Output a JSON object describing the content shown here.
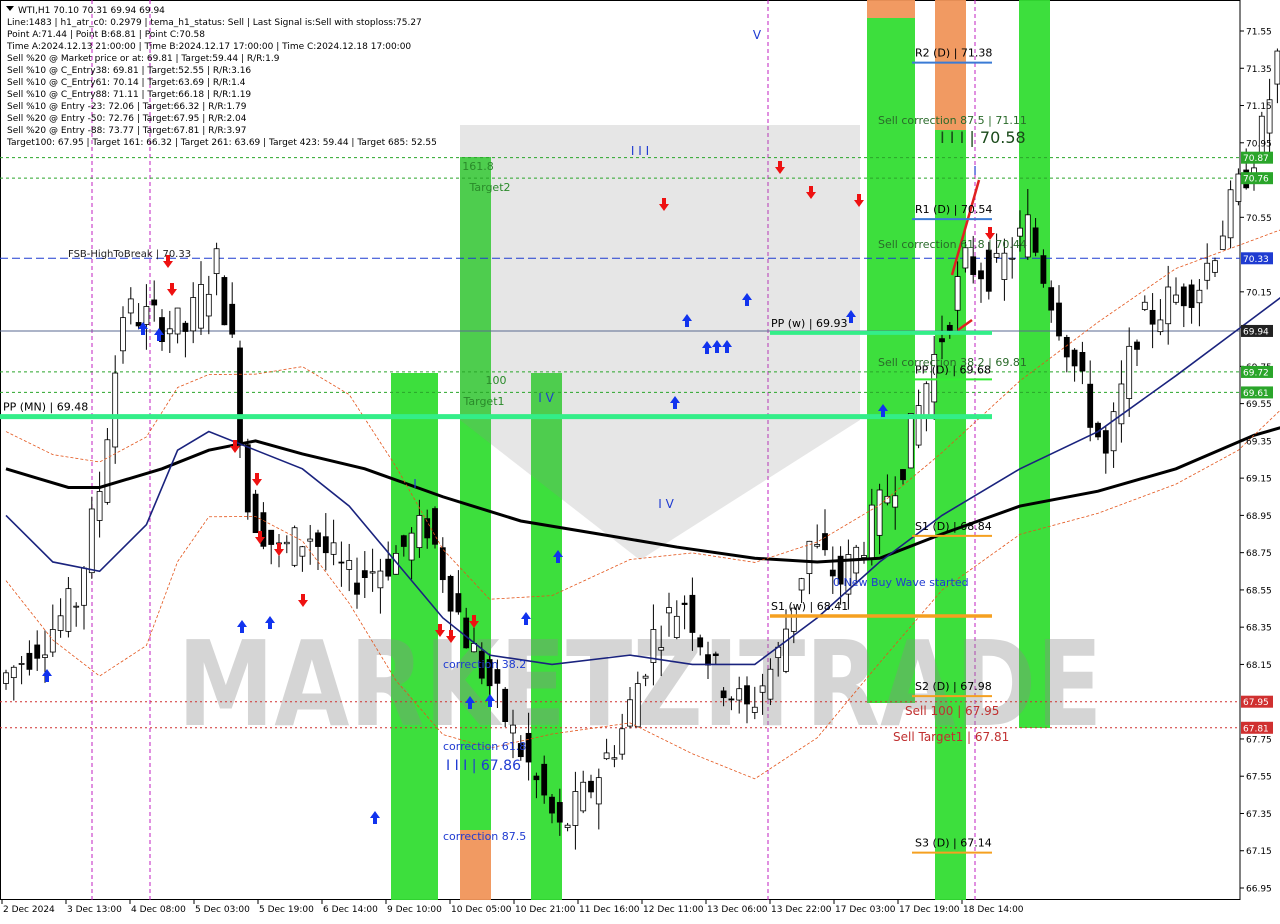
{
  "header": {
    "lines": [
      "WTI,H1  70.10 70.31 69.94 69.94",
      "Line:1483  | h1_atr_c0: 0.2979  | tema_h1_status: Sell  | Last Signal is:Sell with stoploss:75.27",
      "Point A:71.44  | Point B:68.81  | Point C:70.58",
      "Time A:2024.12.13 21:00:00  | Time B:2024.12.17 17:00:00  | Time C:2024.12.18 17:00:00",
      "Sell %20 @ Market price or at: 69.81  | Target:59.44  | R/R:1.9",
      "Sell %10 @ C_Entry38: 69.81  | Target:52.55  | R/R:3.16",
      "Sell %10 @ C_Entry61: 70.14  | Target:63.69  | R/R:1.4",
      "Sell %10 @ C_Entry88: 71.11  | Target:66.18  | R/R:1.19",
      "Sell %10 @ Entry -23: 72.06  | Target:66.32  | R/R:1.79",
      "Sell %20 @ Entry -50: 72.76  | Target:67.95  | R/R:2.04",
      "Sell %20 @ Entry -88: 73.77  | Target:67.81  | R/R:3.97",
      "Target100: 67.95  | Target 161: 66.32  | Target 261: 63.69  | Target 423: 59.44  | Target 685: 52.55"
    ]
  },
  "chart_data": {
    "type": "line",
    "symbol": "WTI",
    "timeframe": "H1",
    "ylim": [
      66.85,
      71.65
    ],
    "y_ticks": [
      71.55,
      71.35,
      71.15,
      70.95,
      70.55,
      70.15,
      69.75,
      69.55,
      69.35,
      69.15,
      68.95,
      68.75,
      68.55,
      68.35,
      68.15,
      67.75,
      67.55,
      67.35,
      67.15,
      66.95
    ],
    "x_labels": [
      "2 Dec 2024",
      "3 Dec 13:00",
      "4 Dec 08:00",
      "5 Dec 03:00",
      "5 Dec 19:00",
      "6 Dec 14:00",
      "9 Dec 10:00",
      "10 Dec 05:00",
      "10 Dec 21:00",
      "11 Dec 16:00",
      "12 Dec 11:00",
      "13 Dec 06:00",
      "13 Dec 22:00",
      "17 Dec 03:00",
      "17 Dec 19:00",
      "18 Dec 14:00"
    ],
    "price_tags": [
      {
        "label": "70.87",
        "value": 70.87,
        "color": "#2aa52a"
      },
      {
        "label": "70.76",
        "value": 70.76,
        "color": "#2aa52a"
      },
      {
        "label": "70.33",
        "value": 70.33,
        "color": "#1f3bd1"
      },
      {
        "label": "69.94",
        "value": 69.94,
        "color": "#222222"
      },
      {
        "label": "69.72",
        "value": 69.72,
        "color": "#2aa52a"
      },
      {
        "label": "69.61",
        "value": 69.61,
        "color": "#2aa52a"
      },
      {
        "label": "67.95",
        "value": 67.95,
        "color": "#d03030"
      },
      {
        "label": "67.81",
        "value": 67.81,
        "color": "#d03030"
      }
    ],
    "levels": [
      {
        "label": "R2 (D) | 71.38",
        "value": 71.38,
        "color": "#3a7bd5"
      },
      {
        "label": "R1 (D) | 70.54",
        "value": 70.54,
        "color": "#3a7bd5"
      },
      {
        "label": "PP (D) | 69.68",
        "value": 69.68,
        "color": "#33ee33"
      },
      {
        "label": "S1 (D) | 68.84",
        "value": 68.84,
        "color": "#f5a020"
      },
      {
        "label": "S2 (D) | 67.98",
        "value": 67.98,
        "color": "#f5a020"
      },
      {
        "label": "S3 (D) | 67.14",
        "value": 67.14,
        "color": "#f5a020"
      },
      {
        "label": "PP (w) | 69.93",
        "value": 69.93,
        "color": "#33ee88"
      },
      {
        "label": "S1 (w) | 68.41",
        "value": 68.41,
        "color": "#f5a020"
      },
      {
        "label": "PP (MN) | 69.48",
        "value": 69.48,
        "color": "#33ee88"
      }
    ],
    "annotations": [
      {
        "text": "FSB-HighToBreak | 70.33",
        "color": "#222222"
      },
      {
        "text": "161.8",
        "color": "#2a8a2a"
      },
      {
        "text": "Target2",
        "color": "#2a8a2a"
      },
      {
        "text": "100",
        "color": "#2a8a2a"
      },
      {
        "text": "Target1",
        "color": "#2a8a2a"
      },
      {
        "text": "correction 38.2",
        "color": "#1f3bd1"
      },
      {
        "text": "correction 61.8",
        "color": "#1f3bd1"
      },
      {
        "text": "I I I | 67.86",
        "color": "#1f3bd1"
      },
      {
        "text": "correction 87.5",
        "color": "#1f3bd1"
      },
      {
        "text": "Sell correction 87.5 | 71.11",
        "color": "#2a6a2a"
      },
      {
        "text": "I I I | 70.58",
        "color": "#1a4a1a"
      },
      {
        "text": "Sell correction 61.8 | 70.44",
        "color": "#2a6a2a"
      },
      {
        "text": "Sell correction 38.2 | 69.81",
        "color": "#2a6a2a"
      },
      {
        "text": "0 New Buy Wave started",
        "color": "#1f3bd1"
      },
      {
        "text": "Sell 100 | 67.95",
        "color": "#c03030"
      },
      {
        "text": "Sell Target1 | 67.81",
        "color": "#c03030"
      }
    ],
    "wave_labels": [
      "V",
      "I I I",
      "I V",
      "I",
      "I V",
      "I"
    ],
    "watermark": "MARKETZITRADE",
    "grid": false
  }
}
